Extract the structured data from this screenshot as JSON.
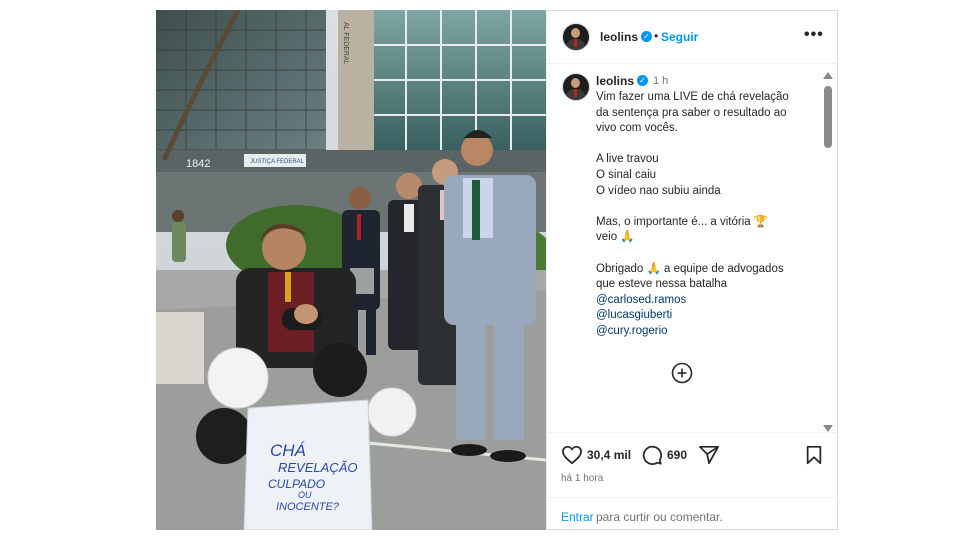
{
  "photo": {
    "building_number": "1842",
    "building_sign": "JUSTIÇA FEDERAL",
    "building_facade_text": "AL FEDERAL",
    "box_text_1": "CHÁ",
    "box_text_2": "REVELAÇÃO",
    "box_text_3": "CULPADO",
    "box_text_4": "OU",
    "box_text_5": "INOCENTE?"
  },
  "header": {
    "username": "leolins",
    "verified_mark": "✓",
    "separator": "•",
    "follow_label": "Seguir",
    "more_label": "•••"
  },
  "caption": {
    "username": "leolins",
    "verified_mark": "✓",
    "time": "1 h",
    "lines": [
      "Vim fazer uma LIVE de chá revelação",
      "da sentença pra saber o resultado ao",
      "vivo com vocês.",
      "",
      "A live travou",
      "O sinal caiu",
      "O vídeo nao subiu ainda",
      "",
      "Mas, o importante é... a vitória 🏆",
      "veio 🙏",
      "",
      "Obrigado 🙏 a equipe de advogados",
      "que esteve nessa batalha"
    ],
    "mentions": [
      "@carlosed.ramos",
      "@lucasgiuberti",
      "@cury.rogerio"
    ]
  },
  "actions": {
    "likes": "30,4 mil",
    "comments": "690",
    "posted_ago": "há 1 hora"
  },
  "add_comment": {
    "login_label": "Entrar",
    "prompt": "para curtir ou comentar."
  },
  "colors": {
    "accent": "#0095f6",
    "mention": "#00376b",
    "muted": "#737373",
    "border": "#dbdbdb"
  },
  "icons": [
    "heart-icon",
    "comment-icon",
    "share-icon",
    "bookmark-icon",
    "add-circle-icon",
    "verified-icon",
    "more-icon"
  ]
}
